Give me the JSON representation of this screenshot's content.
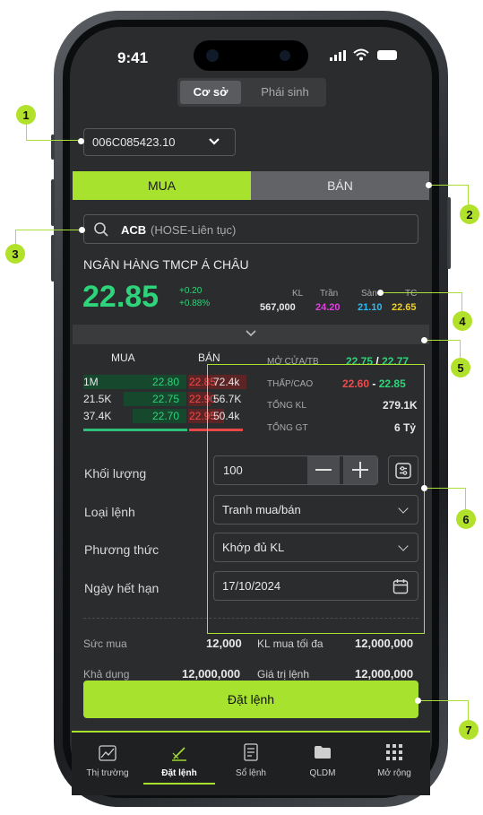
{
  "status_bar": {
    "time": "9:41"
  },
  "market_toggle": {
    "active": "Cơ sở",
    "inactive": "Phái sinh"
  },
  "account": {
    "number": "006C085423.10"
  },
  "trade_tabs": {
    "buy": "MUA",
    "sell": "BÁN"
  },
  "search": {
    "symbol": "ACB",
    "exchange": "(HOSE-Liên tục)"
  },
  "company": {
    "name": "NGÂN HÀNG TMCP Á CHÂU"
  },
  "quote": {
    "price": "22.85",
    "change": "+0.20",
    "change_pct": "+0.88%",
    "headers": {
      "kl": "KL",
      "tran": "Trần",
      "san": "Sàn",
      "tc": "TC"
    },
    "kl": "567,000",
    "tran": "24.20",
    "san": "21.10",
    "tc": "22.65"
  },
  "orderbook": {
    "buy_header": "MUA",
    "sell_header": "BÁN",
    "rows": [
      {
        "bid_vol": "1M",
        "bid": "22.80",
        "ask": "22.85",
        "ask_vol": "72.4k"
      },
      {
        "bid_vol": "21.5K",
        "bid": "22.75",
        "ask": "22.90",
        "ask_vol": "56.7K"
      },
      {
        "bid_vol": "37.4K",
        "bid": "22.70",
        "ask": "22.95",
        "ask_vol": "50.4k"
      }
    ]
  },
  "stats": {
    "open_label": "MỞ CỬA/TB",
    "open": "22.75",
    "avg": "22.77",
    "sep": "/",
    "lowhigh_label": "THẤP/CAO",
    "low": "22.60",
    "dash": "-",
    "high": "22.85",
    "vol_label": "TỔNG KL",
    "vol": "279.1K",
    "value_label": "TỔNG GT",
    "value": "6 Tỷ"
  },
  "form": {
    "qty_label": "Khối lượng",
    "qty_value": "100",
    "type_label": "Loại lệnh",
    "type_value": "Tranh mua/bán",
    "method_label": "Phương thức",
    "method_value": "Khớp đủ KL",
    "expiry_label": "Ngày hết hạn",
    "expiry_value": "17/10/2024"
  },
  "summary": {
    "buying_power_label": "Sức mua",
    "buying_power": "12,000",
    "max_qty_label": "KL mua tối đa",
    "max_qty": "12,000,000",
    "available_label": "Khả dụng",
    "available": "12,000,000",
    "order_value_label": "Giá trị lệnh",
    "order_value": "12,000,000"
  },
  "submit": {
    "label": "Đặt lệnh"
  },
  "bottom_nav": [
    {
      "label": "Thị trường",
      "icon": "chart-icon"
    },
    {
      "label": "Đặt lệnh",
      "icon": "order-pen-icon",
      "active": true
    },
    {
      "label": "Sổ lệnh",
      "icon": "order-book-icon"
    },
    {
      "label": "QLDM",
      "icon": "folder-icon"
    },
    {
      "label": "Mở rộng",
      "icon": "grid-icon"
    }
  ],
  "callouts": [
    "1",
    "2",
    "3",
    "4",
    "5",
    "6",
    "7"
  ],
  "colors": {
    "accent": "#a6e22e",
    "up": "#2ed47a",
    "down": "#ef4b4b",
    "ceiling": "#e040e0",
    "floor": "#2fb8f0",
    "reference": "#f0d020"
  }
}
